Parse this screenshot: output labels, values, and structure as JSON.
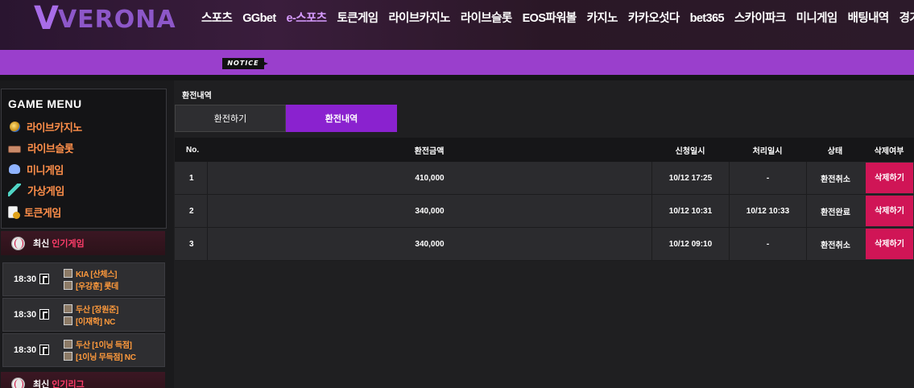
{
  "logo": {
    "v": "V",
    "text": "VERONA"
  },
  "nav": [
    {
      "label": "스포츠"
    },
    {
      "label": "GGbet"
    },
    {
      "label": "e-스포츠",
      "active": true
    },
    {
      "label": "토큰게임"
    },
    {
      "label": "라이브카지노"
    },
    {
      "label": "라이브슬롯"
    },
    {
      "label": "EOS파워볼"
    },
    {
      "label": "카지노"
    },
    {
      "label": "카카오섯다"
    },
    {
      "label": "bet365"
    },
    {
      "label": "스카이파크"
    },
    {
      "label": "미니게임"
    },
    {
      "label": "배팅내역"
    },
    {
      "label": "경기결고"
    }
  ],
  "notice": {
    "tag": "NOTICE"
  },
  "sidebar": {
    "game_menu_title": "GAME MENU",
    "menu": [
      {
        "label": "라이브카지노",
        "icon": "globe-icon"
      },
      {
        "label": "라이브슬롯",
        "icon": "slot-icon"
      },
      {
        "label": "미니게임",
        "icon": "mini-game-icon"
      },
      {
        "label": "가상게임",
        "icon": "virtual-game-icon"
      },
      {
        "label": "토큰게임",
        "icon": "token-game-icon"
      }
    ],
    "popular_games": {
      "prefix": "최신",
      "highlight": "인기게임"
    },
    "matches": [
      {
        "time": "18:30",
        "team1": "KIA [산체스]",
        "team2": "[우강훈] 롯데"
      },
      {
        "time": "18:30",
        "team1": "두산 [장원준]",
        "team2": "[이재학] NC"
      },
      {
        "time": "18:30",
        "team1": "두산 [1이닝 득점]",
        "team2": "[1이닝 무득점] NC"
      }
    ],
    "popular_leagues": {
      "prefix": "최신",
      "highlight": "인기리그"
    }
  },
  "main": {
    "title": "환전내역",
    "tabs": [
      {
        "label": "환전하기",
        "active": false
      },
      {
        "label": "환전내역",
        "active": true
      }
    ],
    "columns": {
      "no": "No.",
      "amount": "환전금액",
      "request_date": "신청일시",
      "process_date": "처리일시",
      "status": "상태",
      "delete": "삭제여부"
    },
    "rows": [
      {
        "no": "1",
        "amount": "410,000",
        "request_date": "10/12 17:25",
        "process_date": "-",
        "status": "환전취소",
        "delete": "삭제하기"
      },
      {
        "no": "2",
        "amount": "340,000",
        "request_date": "10/12 10:31",
        "process_date": "10/12 10:33",
        "status": "환전완료",
        "delete": "삭제하기"
      },
      {
        "no": "3",
        "amount": "340,000",
        "request_date": "10/12 09:10",
        "process_date": "-",
        "status": "환전취소",
        "delete": "삭제하기"
      }
    ]
  },
  "colors": {
    "accent": "#8a22cf",
    "notice_bar": "#9a3fcc",
    "delete_button": "#d01556",
    "menu_label": "#ff8f4a",
    "team_label": "#ff9a3c"
  }
}
